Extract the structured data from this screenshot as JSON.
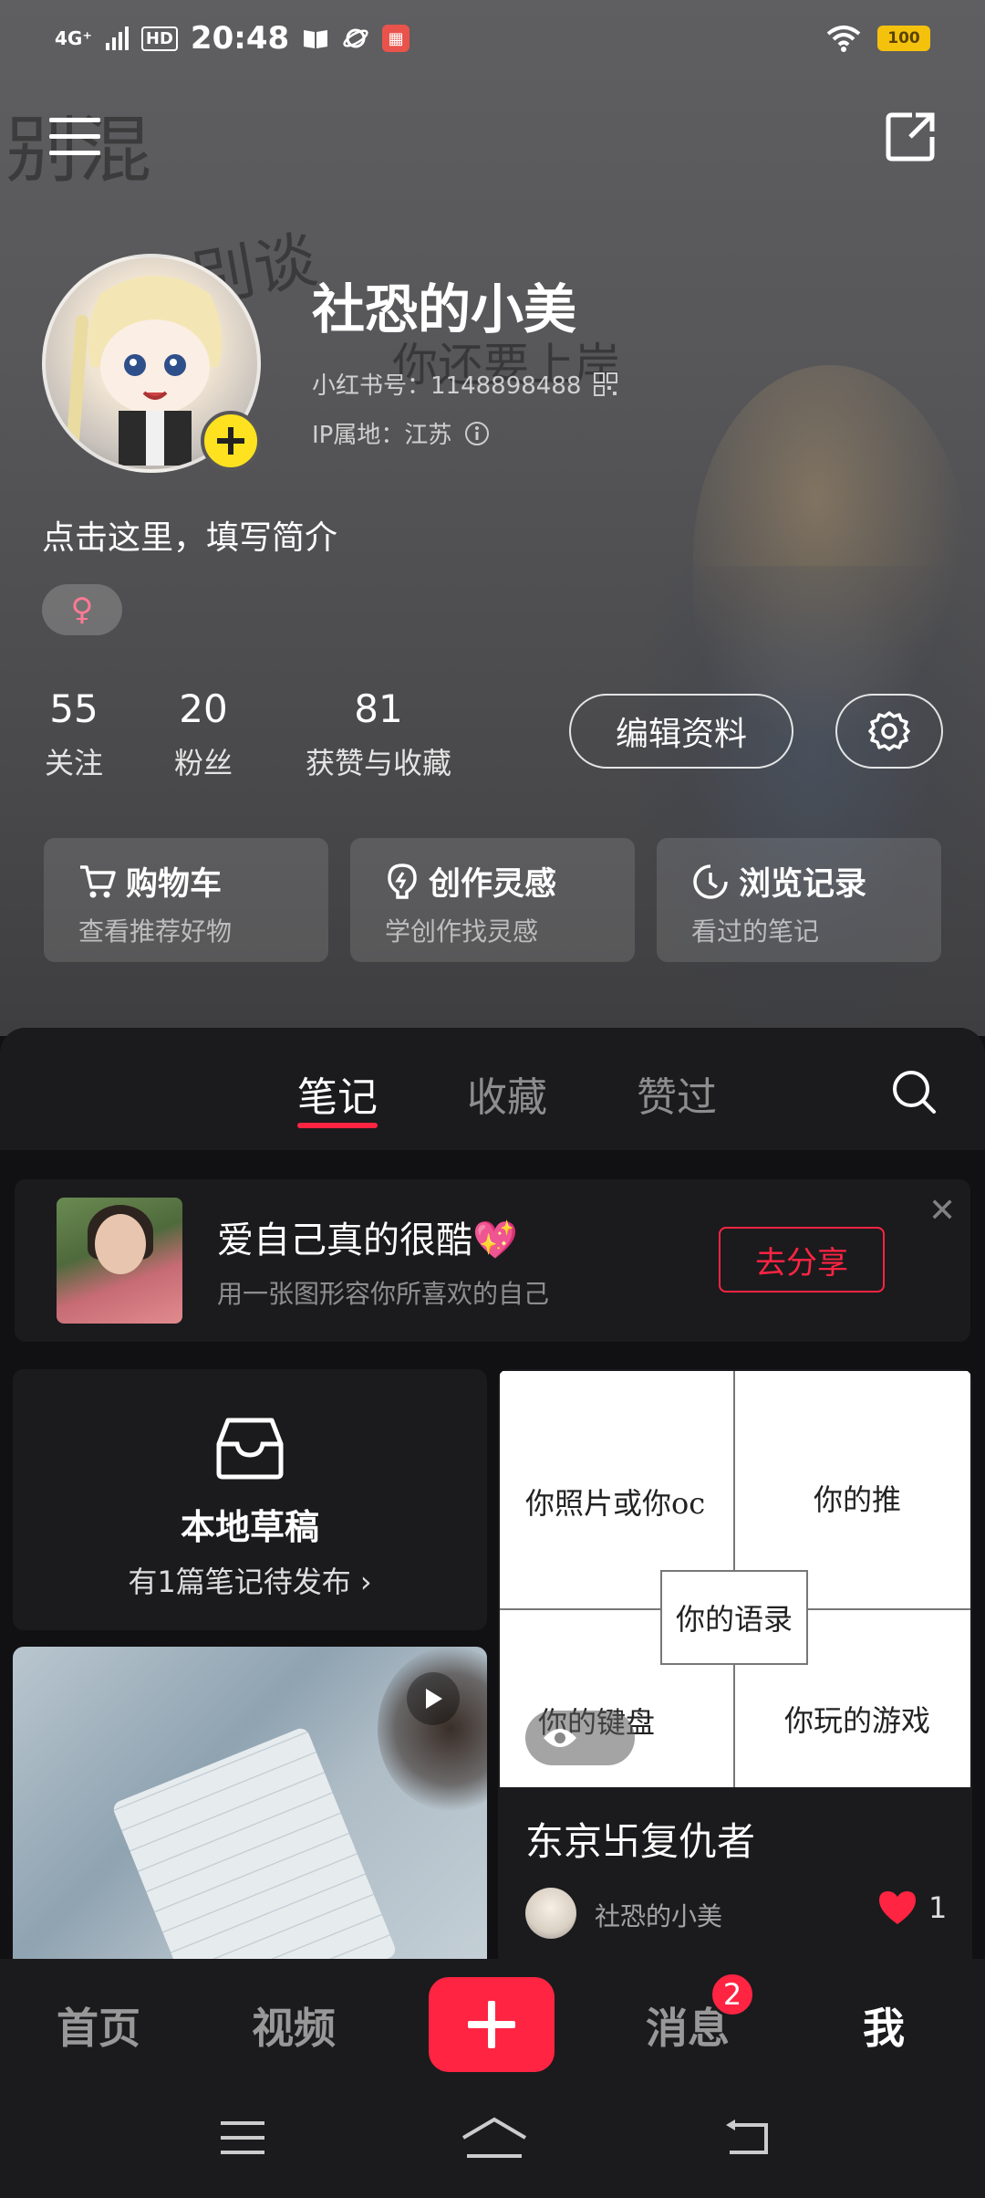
{
  "status_bar": {
    "network": "4G⁺",
    "hd": "HD",
    "time": "20:48",
    "battery": "100"
  },
  "profile": {
    "nickname": "社恐的小美",
    "redbook_id": "小红书号：1148898488",
    "ip_location": "IP属地：江苏",
    "bio": "点击这里，填写简介",
    "gender": "♀"
  },
  "stats": [
    {
      "value": "55",
      "label": "关注"
    },
    {
      "value": "20",
      "label": "粉丝"
    },
    {
      "value": "81",
      "label": "获赞与收藏"
    }
  ],
  "actions": {
    "edit_label": "编辑资料"
  },
  "quick_links": [
    {
      "title": "购物车",
      "subtitle": "查看推荐好物"
    },
    {
      "title": "创作灵感",
      "subtitle": "学创作找灵感"
    },
    {
      "title": "浏览记录",
      "subtitle": "看过的笔记"
    }
  ],
  "tabs": [
    "笔记",
    "收藏",
    "赞过"
  ],
  "banner": {
    "title": "爱自己真的很酷💖",
    "subtitle": "用一张图形容你所喜欢的自己",
    "button": "去分享",
    "close": "✕"
  },
  "draft": {
    "title": "本地草稿",
    "subtitle": "有1篇笔记待发布 ›"
  },
  "note": {
    "image_texts": {
      "top_left": "你照片或你oc",
      "top_right": "你的推",
      "center": "你的语录",
      "bottom_left": "你的键盘",
      "bottom_right": "你玩的游戏"
    },
    "title": "东京卐复仇者",
    "author": "社恐的小美",
    "likes": "1"
  },
  "bottom_nav": {
    "home": "首页",
    "video": "视频",
    "messages": "消息",
    "messages_badge": "2",
    "me": "我"
  },
  "colors": {
    "accent": "#ff2442",
    "avatar_badge": "#ffe21f",
    "battery": "#f4c20d"
  },
  "icons": [
    "menu-icon",
    "share-icon",
    "qrcode-icon",
    "info-icon",
    "settings-icon",
    "cart-icon",
    "lightbulb-icon",
    "clock-icon",
    "search-icon",
    "inbox-icon",
    "play-icon",
    "eye-icon",
    "heart-icon",
    "plus-icon"
  ]
}
